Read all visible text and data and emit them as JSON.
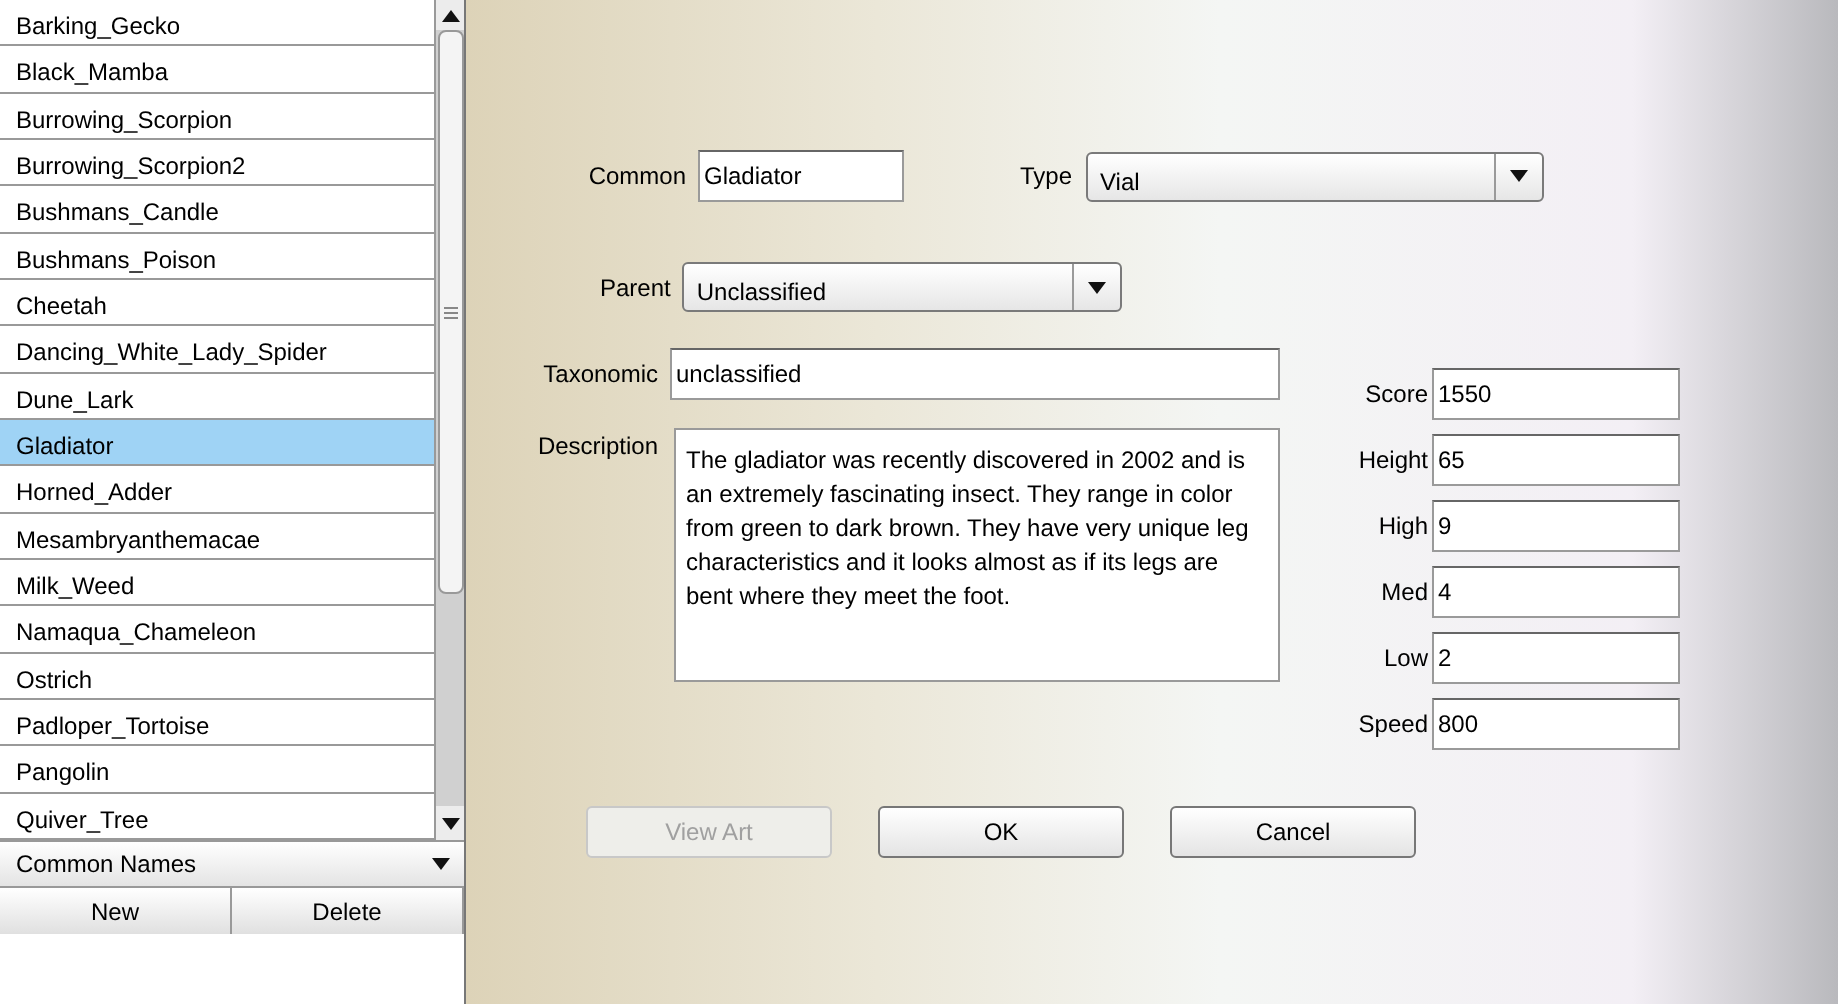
{
  "list": {
    "items": [
      {
        "label": "Barking_Gecko",
        "selected": false
      },
      {
        "label": "Black_Mamba",
        "selected": false
      },
      {
        "label": "Burrowing_Scorpion",
        "selected": false
      },
      {
        "label": "Burrowing_Scorpion2",
        "selected": false
      },
      {
        "label": "Bushmans_Candle",
        "selected": false
      },
      {
        "label": "Bushmans_Poison",
        "selected": false
      },
      {
        "label": "Cheetah",
        "selected": false
      },
      {
        "label": "Dancing_White_Lady_Spider",
        "selected": false
      },
      {
        "label": "Dune_Lark",
        "selected": false
      },
      {
        "label": "Gladiator",
        "selected": true
      },
      {
        "label": "Horned_Adder",
        "selected": false
      },
      {
        "label": "Mesambryanthemacae",
        "selected": false
      },
      {
        "label": "Milk_Weed",
        "selected": false
      },
      {
        "label": "Namaqua_Chameleon",
        "selected": false
      },
      {
        "label": "Ostrich",
        "selected": false
      },
      {
        "label": "Padloper_Tortoise",
        "selected": false
      },
      {
        "label": "Pangolin",
        "selected": false
      },
      {
        "label": "Quiver_Tree",
        "selected": false
      }
    ]
  },
  "name_mode": {
    "value": "Common Names"
  },
  "list_buttons": [
    {
      "label": "New"
    },
    {
      "label": "Delete"
    }
  ],
  "form": {
    "common": {
      "label": "Common",
      "value": "Gladiator"
    },
    "type": {
      "label": "Type",
      "value": "Vial"
    },
    "parent": {
      "label": "Parent",
      "value": "Unclassified"
    },
    "taxonomic": {
      "label": "Taxonomic",
      "value": "unclassified"
    },
    "description": {
      "label": "Description",
      "value": "The gladiator was recently discovered in 2002 and is an extremely fascinating insect. They range in color from green to dark brown. They have very unique leg characteristics and it looks almost as if its legs are bent where they meet the foot."
    },
    "stats": [
      {
        "label": "Score",
        "value": "1550"
      },
      {
        "label": "Height",
        "value": "65"
      },
      {
        "label": "High",
        "value": "9"
      },
      {
        "label": "Med",
        "value": "4"
      },
      {
        "label": "Low",
        "value": "2"
      },
      {
        "label": "Speed",
        "value": "800"
      }
    ]
  },
  "buttons": [
    {
      "label": "View Art",
      "disabled": true
    },
    {
      "label": "OK",
      "disabled": false
    },
    {
      "label": "Cancel",
      "disabled": false
    }
  ]
}
